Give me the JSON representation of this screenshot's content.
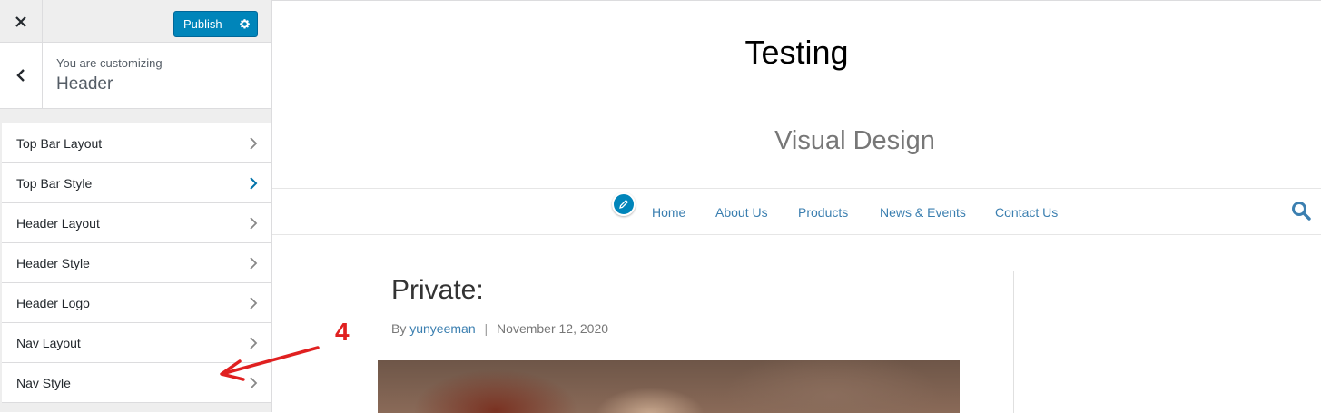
{
  "customizer": {
    "publish_label": "Publish",
    "customizing_label": "You are customizing",
    "section_title": "Header",
    "menu_items": [
      {
        "label": "Top Bar Layout"
      },
      {
        "label": "Top Bar Style"
      },
      {
        "label": "Header Layout"
      },
      {
        "label": "Header Style"
      },
      {
        "label": "Header Logo"
      },
      {
        "label": "Nav Layout"
      },
      {
        "label": "Nav Style"
      }
    ]
  },
  "preview": {
    "site_title": "Testing",
    "site_tagline": "Visual Design",
    "nav": [
      {
        "label": "Home"
      },
      {
        "label": "About Us"
      },
      {
        "label": "Products"
      },
      {
        "label": "News & Events"
      },
      {
        "label": "Contact Us"
      }
    ],
    "post": {
      "title": "Private:",
      "by_label": "By",
      "author": "yunyeeman",
      "separator": "|",
      "date": "November 12, 2020"
    }
  },
  "annotation": {
    "step_number": "4",
    "color": "#e02020"
  },
  "colors": {
    "accent": "#0085ba",
    "link": "#3b7fb0"
  },
  "icons": [
    "close-icon",
    "gear-icon",
    "back-arrow-icon",
    "chevron-right-icon",
    "pencil-icon",
    "search-icon"
  ]
}
